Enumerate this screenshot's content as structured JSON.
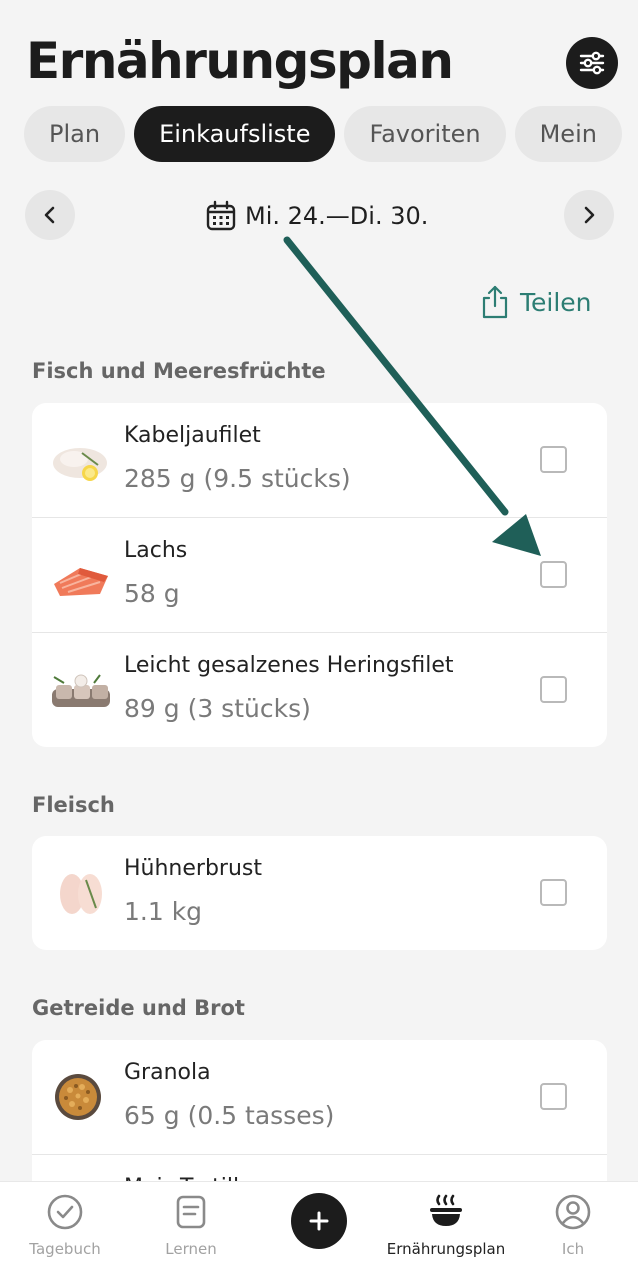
{
  "header": {
    "title": "Ernährungsplan"
  },
  "tabs": [
    {
      "label": "Plan",
      "active": false
    },
    {
      "label": "Einkaufsliste",
      "active": true
    },
    {
      "label": "Favoriten",
      "active": false
    },
    {
      "label": "Mein",
      "active": false
    }
  ],
  "date_nav": {
    "range": "Mi. 24.—Di. 30."
  },
  "share": {
    "label": "Teilen"
  },
  "sections": [
    {
      "title": "Fisch und Meeresfrüchte",
      "items": [
        {
          "name": "Kabeljaufilet",
          "qty": "285 g (9.5 stücks)"
        },
        {
          "name": "Lachs",
          "qty": "58 g"
        },
        {
          "name": "Leicht gesalzenes Heringsfilet",
          "qty": "89 g (3 stücks)"
        }
      ]
    },
    {
      "title": "Fleisch",
      "items": [
        {
          "name": "Hühnerbrust",
          "qty": "1.1 kg"
        }
      ]
    },
    {
      "title": "Getreide und Brot",
      "items": [
        {
          "name": "Granola",
          "qty": "65 g (0.5 tasses)"
        },
        {
          "name": "Mais-Tortilla",
          "qty": ""
        }
      ]
    }
  ],
  "bottom_nav": {
    "items": [
      {
        "label": "Tagebuch",
        "icon": "check-circle-icon"
      },
      {
        "label": "Lernen",
        "icon": "document-icon"
      },
      {
        "label": "Ernährungsplan",
        "icon": "bowl-icon",
        "active": true
      },
      {
        "label": "Ich",
        "icon": "user-circle-icon"
      }
    ]
  },
  "colors": {
    "accent": "#2c7d73",
    "dark": "#1c1c1c",
    "arrow": "#1f5f58"
  }
}
